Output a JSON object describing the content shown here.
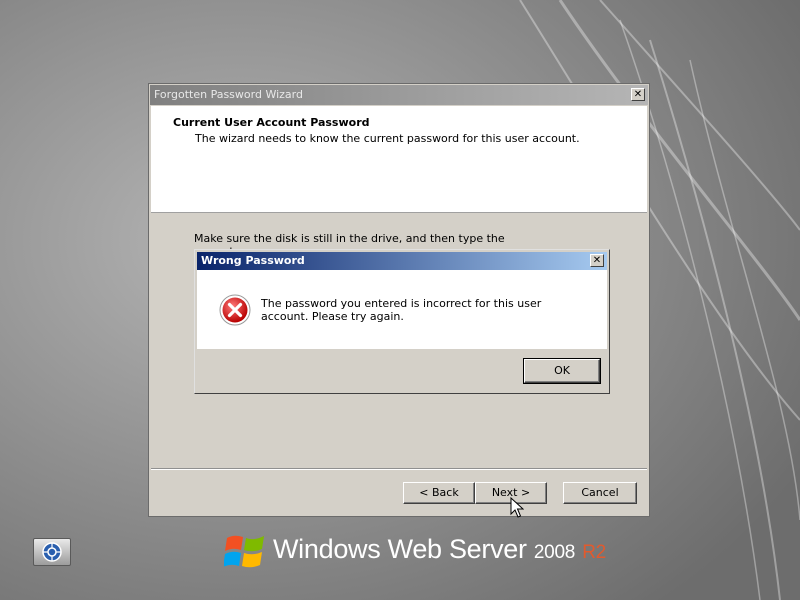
{
  "wizard": {
    "title": "Forgotten Password Wizard",
    "close_glyph": "✕",
    "header_title": "Current User Account Password",
    "header_subtitle": "The wizard needs to know the current password for this user account.",
    "instruction": "Make sure the disk is still in the drive, and then type the current user",
    "back_label": "< Back",
    "next_label": "Next >",
    "cancel_label": "Cancel"
  },
  "dialog": {
    "title": "Wrong Password",
    "close_glyph": "✕",
    "message": "The password you entered is incorrect for this user account. Please try again.",
    "ok_label": "OK",
    "icon": "error-icon",
    "icon_color": "#d40000"
  },
  "branding": {
    "product": "Windows",
    "edition": "Web Server",
    "version": "2008",
    "release": "R2"
  },
  "taskbar": {
    "icon": "ease-of-access-icon"
  }
}
